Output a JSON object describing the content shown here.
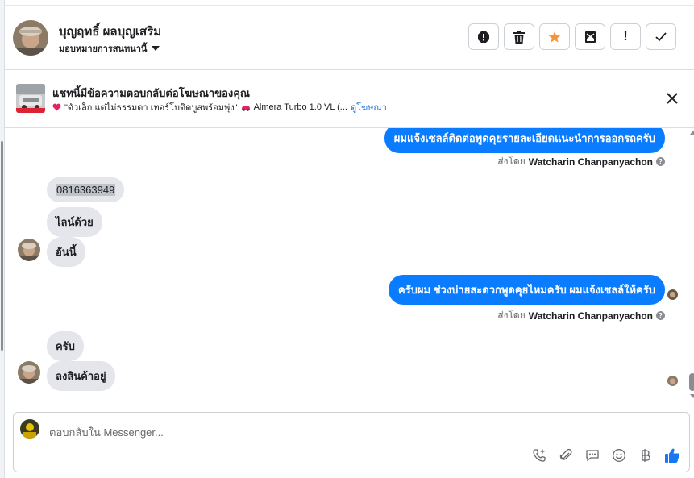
{
  "contact": {
    "name": "บุญฤทธิ์ ผลบุญเสริม",
    "assign_label": "มอบหมายการสนทนานี้"
  },
  "header_actions": [
    {
      "name": "report-spam-icon",
      "label": "!"
    },
    {
      "name": "trash-icon",
      "label": ""
    },
    {
      "name": "star-icon",
      "label": ""
    },
    {
      "name": "mark-unread-icon",
      "label": ""
    },
    {
      "name": "follow-up-icon",
      "label": "!"
    },
    {
      "name": "done-check-icon",
      "label": ""
    }
  ],
  "ad_banner": {
    "title": "แชทนี้มีข้อความตอบกลับต่อโฆษณาของคุณ",
    "ad_text": "\"ตัวเล็ก แต่ไม่ธรรมดา เทอร์โบติดบูสพร้อมพุ่ง\"",
    "car_name": "Almera Turbo 1.0 VL (...",
    "view_ad_link": "ดูโฆษณา"
  },
  "messages": {
    "out_1": "ผมแจ้งเซลล์ติดต่อพูดคุยรายละเอียดแนะนำการออกรถครับ",
    "sent_by_1_prefix": "ส่งโดย",
    "sent_by_1_name": "Watcharin Chanpanyachon",
    "in_1": "0816363949",
    "in_2": "ไลน์ด้วย",
    "in_3": "อันนี้",
    "out_2": "ครับผม ช่วงบ่ายสะดวกพูดคุยไหมครับ ผมแจ้งเซลล์ให้ครับ",
    "sent_by_2_prefix": "ส่งโดย",
    "sent_by_2_name": "Watcharin Chanpanyachon",
    "in_4": "ครับ",
    "in_5": "ลงสินค้าอยู่"
  },
  "composer": {
    "placeholder": "ตอบกลับใน Messenger..."
  },
  "colors": {
    "accent": "#0a7cff",
    "star": "#f7923b",
    "like": "#1877f2"
  }
}
